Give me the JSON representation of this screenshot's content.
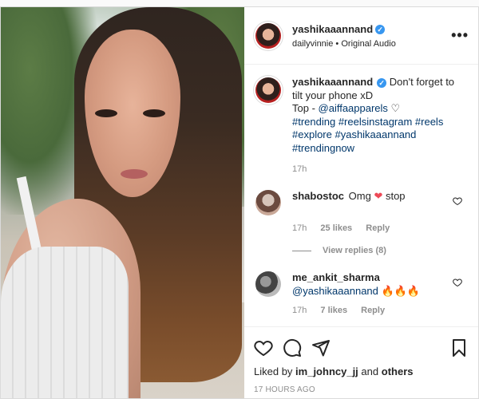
{
  "post": {
    "header": {
      "username": "yashikaaannand",
      "verified_mark": "✓",
      "audio_owner": "dailyvinnie",
      "separator": " • ",
      "audio_label": "Original Audio",
      "more_label": "•••"
    },
    "caption": {
      "username": "yashikaaannand",
      "text": "Don't forget to tilt your phone xD",
      "line2_prefix": "Top - ",
      "mention": "@aiffaapparels",
      "heart": "♡",
      "hashtags": "#trending #reelsinstagram #reels #explore #yashikaaannand #trendingnow",
      "time": "17h"
    },
    "comments": [
      {
        "username": "shabostoc",
        "text_before": "Omg",
        "emoji": "❤",
        "text_after": "stop",
        "time": "17h",
        "likes": "25 likes",
        "reply": "Reply",
        "view_replies": "View replies (8)"
      },
      {
        "username": "me_ankit_sharma",
        "mention": "@yashikaaannand",
        "emoji": "🔥🔥🔥",
        "time": "17h",
        "likes": "7 likes",
        "reply": "Reply"
      }
    ],
    "footer": {
      "liked_by_prefix": "Liked by",
      "liked_by_user": "im_johncy_jj",
      "and": "and",
      "others": "others",
      "timestamp": "17 HOURS AGO"
    },
    "icons": {
      "like": "heart-icon",
      "comment": "comment-icon",
      "share": "share-icon",
      "save": "bookmark-icon",
      "more": "more-options-icon",
      "comment_like": "heart-outline-icon"
    },
    "colors": {
      "link": "#00376b",
      "verified": "#3897f0",
      "muted": "#8e8e8e",
      "heart_red": "#ed4956"
    }
  }
}
